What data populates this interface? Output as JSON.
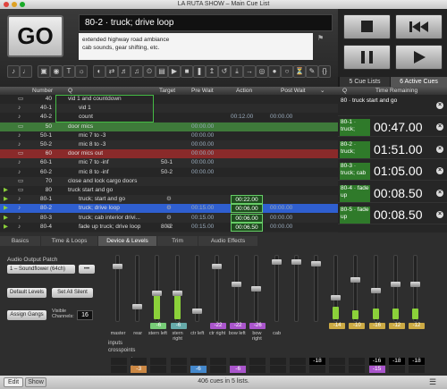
{
  "window": {
    "title": "LA RUTA SHOW – Main Cue List"
  },
  "go": {
    "label": "GO"
  },
  "cue": {
    "name": "80-2 · truck; drive loop",
    "notes": [
      "extended highway road ambiance",
      "cab sounds, gear shifting, etc."
    ]
  },
  "toolbar": {
    "icons": [
      "speaker-icon",
      "microphone-icon",
      "video-icon",
      "camera-icon",
      "text-icon",
      "light-icon",
      "fade-icon",
      "network-icon",
      "midi-icon",
      "midi-file-icon",
      "timecode-icon",
      "group-icon",
      "start-icon",
      "stop-icon",
      "pause-icon",
      "load-icon",
      "reset-icon",
      "devamp-icon",
      "goto-icon",
      "target-icon",
      "arm-icon",
      "disarm-icon",
      "wait-icon",
      "memo-icon",
      "script-icon"
    ]
  },
  "columns": {
    "number": "Number",
    "q": "Q",
    "target": "Target",
    "pre_wait": "Pre Wait",
    "action": "Action",
    "post_wait": "Post Wait"
  },
  "cues": [
    {
      "num": "40",
      "name": "vid 1 and countdown",
      "target": "",
      "pre": "",
      "action": "",
      "post": "",
      "type": "group"
    },
    {
      "num": "40-1",
      "name": "vid 1",
      "target": "",
      "pre": "",
      "action": "",
      "post": "",
      "type": "child"
    },
    {
      "num": "40-2",
      "name": "count",
      "target": "",
      "pre": "",
      "action": "00:12.00",
      "post": "00:00.00",
      "type": "child"
    },
    {
      "num": "50",
      "name": "door mics",
      "target": "",
      "pre": "00:00.00",
      "action": "",
      "post": "",
      "type": "group-green"
    },
    {
      "num": "50-1",
      "name": "mic 7 to -3",
      "target": "",
      "pre": "00:00.00",
      "action": "",
      "post": "",
      "type": "child"
    },
    {
      "num": "50-2",
      "name": "mic 8 to -3",
      "target": "",
      "pre": "00:00.00",
      "action": "",
      "post": "",
      "type": "child"
    },
    {
      "num": "60",
      "name": "door mics out",
      "target": "",
      "pre": "00:00.00",
      "action": "",
      "post": "",
      "type": "group-red"
    },
    {
      "num": "60-1",
      "name": "mic 7 to -inf",
      "target": "50-1",
      "pre": "00:00.00",
      "action": "",
      "post": "",
      "type": "child"
    },
    {
      "num": "60-2",
      "name": "mic 8 to -inf",
      "target": "50-2",
      "pre": "00:00.00",
      "action": "",
      "post": "",
      "type": "child"
    },
    {
      "num": "70",
      "name": "close and lock cargo doors",
      "target": "",
      "pre": "",
      "action": "",
      "post": "",
      "type": "group"
    },
    {
      "num": "80",
      "name": "truck start and go",
      "target": "",
      "pre": "",
      "action": "",
      "post": "",
      "type": "group"
    },
    {
      "num": "80-1",
      "name": "truck; start and go",
      "target": "",
      "pre": "",
      "action": "00:22.00",
      "post": "",
      "type": "child"
    },
    {
      "num": "80-2",
      "name": "truck; drive loop",
      "target": "",
      "pre": "00:15.00",
      "action": "00:06.00",
      "post": "00:00.00",
      "type": "selected"
    },
    {
      "num": "80-3",
      "name": "truck; cab interior drivi...",
      "target": "",
      "pre": "00:15.00",
      "action": "00:06.00",
      "post": "00:00.00",
      "type": "child"
    },
    {
      "num": "80-4",
      "name": "fade up truck; drive loop",
      "target": "80-2",
      "pre": "00:15.00",
      "action": "00:06.50",
      "post": "00:00.00",
      "type": "child"
    }
  ],
  "side_tabs": {
    "lists": "5 Cue Lists",
    "active": "6 Active Cues"
  },
  "side_header": {
    "q": "Q",
    "time": "Time Remaining"
  },
  "active_cues": [
    {
      "name": "80 · truck start and go",
      "time": ""
    },
    {
      "name": "80-1 · truck;",
      "time": "00:47.00"
    },
    {
      "name": "80-2 · truck;",
      "time": "01:51.00"
    },
    {
      "name": "80-3 · truck; cab",
      "time": "01:05.00"
    },
    {
      "name": "80-4 · fade up",
      "time": "00:08.50"
    },
    {
      "name": "80-5 · fade up",
      "time": "00:08.50"
    }
  ],
  "bottom_tabs": [
    "Basics",
    "Time & Loops",
    "Device & Levels",
    "Trim",
    "Audio Effects"
  ],
  "inspector": {
    "patch_label": "Audio Output Patch",
    "patch_value": "1 – Soundflower (64ch)",
    "default_levels": "Default Levels",
    "set_all_silent": "Set All Silent",
    "assign_gangs": "Assign Gangs",
    "visible_channels_label": "Visible Channels:",
    "visible_channels": "16"
  },
  "channels": [
    "master",
    "rear",
    "stern left",
    "stern right",
    "ctr left",
    "ctr right",
    "bow left",
    "bow right",
    "cab",
    "",
    "",
    "",
    "",
    "",
    "",
    ""
  ],
  "channel_levels": [
    "",
    "",
    "-6",
    "-6",
    "",
    "-22",
    "-22",
    "-26",
    "",
    "",
    "",
    "-14",
    "-10",
    "-16",
    "-12",
    "-12"
  ],
  "row_labels": {
    "inputs": "inputs",
    "crosspoints": "crosspoints"
  },
  "row1_values": [
    "",
    "",
    "",
    "",
    "",
    "",
    "",
    "",
    "",
    "",
    "-18",
    "",
    "",
    "-16",
    "-18",
    "-18"
  ],
  "row2_values": [
    "",
    "-3",
    "",
    "",
    "-6",
    "",
    "-6",
    "",
    "",
    "",
    "",
    "",
    "",
    "-15",
    "",
    ""
  ],
  "status": {
    "edit": "Edit",
    "show": "Show",
    "count": "406 cues in 5 lists."
  },
  "colors": {
    "selected": "#2f5fd0",
    "group_green": "#3e7a3a",
    "group_red": "#8a2a2a",
    "level": "#8bd13a",
    "active_green": "#2f7a2a"
  }
}
